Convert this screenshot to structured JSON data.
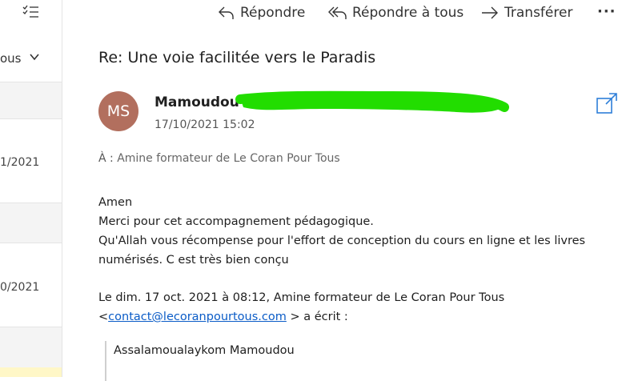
{
  "toolbar": {
    "reply": "Répondre",
    "reply_all": "Répondre à tous",
    "forward": "Transférer",
    "more": "···"
  },
  "list": {
    "filter_label": "ous",
    "dates": [
      "1/2021",
      "0/2021"
    ]
  },
  "message": {
    "subject": "Re: Une voie facilitée vers le Paradis",
    "avatar_initials": "MS",
    "avatar_color": "#b26f5e",
    "sender_name": "Mamoudou",
    "date": "17/10/2021 15:02",
    "to_label": "À :",
    "recipient": "Amine formateur de Le Coran Pour Tous",
    "body_lines": [
      "Amen",
      "Merci pour cet accompagnement pédagogique.",
      "Qu'Allah vous récompense pour l'effort de conception du cours en ligne et les livres numérisés. C est très bien conçu"
    ],
    "quote_header_line1": "Le dim. 17 oct. 2021 à 08:12, Amine formateur de Le Coran Pour Tous",
    "quote_email": "contact@lecoranpourtous.com",
    "quote_header_suffix": "> a écrit :",
    "quote_open": "<",
    "quoted_text": "Assalamoualaykom Mamoudou"
  },
  "colors": {
    "redaction": "#22dd00",
    "link": "#0b5cc7"
  }
}
